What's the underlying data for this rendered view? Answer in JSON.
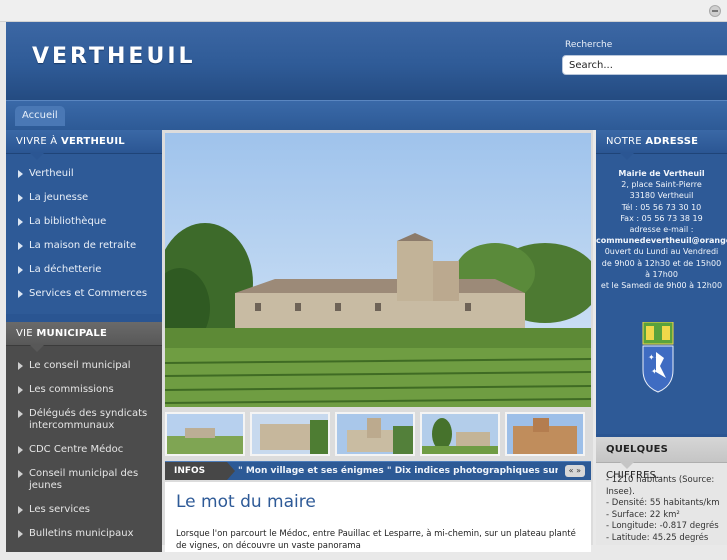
{
  "header": {
    "logo": "VERTHEUIL",
    "search_label": "Recherche",
    "search_placeholder": "Search..."
  },
  "nav": {
    "home": "Accueil"
  },
  "sidebar_left": {
    "vivre_title_a": "VIVRE À",
    "vivre_title_b": "VERTHEUIL",
    "vivre_items": [
      "Vertheuil",
      "La jeunesse",
      "La bibliothèque",
      "La maison de retraite",
      "La déchetterie",
      "Services et Commerces"
    ],
    "municipale_title_a": "VIE",
    "municipale_title_b": "MUNICIPALE",
    "municipale_items": [
      "Le conseil municipal",
      "Les commissions",
      "Délégués des syndicats intercommunaux",
      "CDC Centre Médoc",
      "Conseil municipal des jeunes",
      "Les services",
      "Bulletins municipaux"
    ]
  },
  "infos": {
    "label": "INFOS",
    "text": "\" Mon village et ses énigmes \" Dix indices photographiques sur un pla...",
    "nav": "« »"
  },
  "article": {
    "title": "Le mot du maire",
    "text": "Lorsque l'on parcourt le Médoc, entre Pauillac et Lesparre, à mi-chemin, sur un plateau planté de vignes, on découvre un vaste panorama"
  },
  "sidebar_right": {
    "adresse_title_a": "NOTRE",
    "adresse_title_b": "ADRESSE",
    "adresse_lines": [
      "Mairie de Vertheuil",
      "2, place Saint-Pierre",
      "33180 Vertheuil",
      "Tél : 05 56 73 30 10",
      "Fax : 05 56 73 38 19",
      "adresse e-mail :",
      "communedevertheuil@orange.fr",
      "0uvert du Lundi au Vendredi",
      "de 9h00 à 12h30 et de 15h00",
      "à 17h00",
      "et le Samedi de  9h00 à 12h00"
    ],
    "chiffres_title_a": "QUELQUES",
    "chiffres_title_b": "CHIFFRES...",
    "chiffres_items": [
      "- 1210 habitants (Source: Insee).",
      "- Densité: 55 habitants/km",
      "- Surface: 22 km²",
      "- Longitude: -0.817 degrés",
      "- Latitude: 45.25 degrés"
    ]
  },
  "colors": {
    "brand_blue": "#2e5a97",
    "menu_gray": "#4c4c4c",
    "title_blue": "#2e5a97"
  }
}
